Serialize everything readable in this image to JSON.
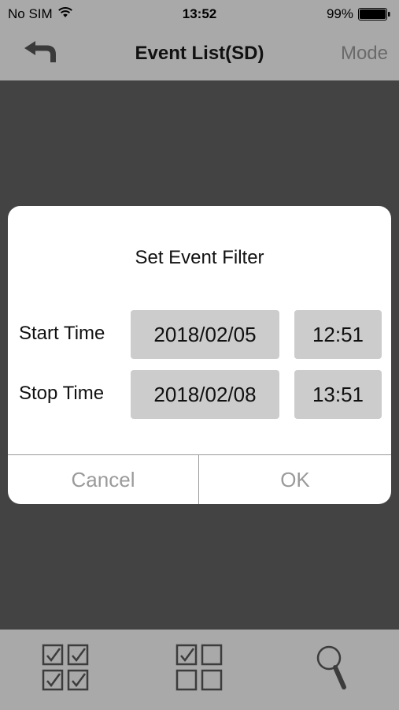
{
  "status_bar": {
    "carrier": "No SIM",
    "time": "13:52",
    "battery": "99%"
  },
  "nav": {
    "title": "Event List(SD)",
    "mode_label": "Mode",
    "back_icon": "back-arrow-icon"
  },
  "dialog": {
    "title": "Set Event Filter",
    "start": {
      "label": "Start Time",
      "date": "2018/02/05",
      "time": "12:51"
    },
    "stop": {
      "label": "Stop Time",
      "date": "2018/02/08",
      "time": "13:51"
    },
    "cancel_label": "Cancel",
    "ok_label": "OK"
  },
  "toolbar": {
    "items": [
      {
        "icon": "select-all-icon"
      },
      {
        "icon": "select-partial-icon"
      },
      {
        "icon": "search-icon"
      }
    ]
  },
  "colors": {
    "bar_background": "#a9a9a9",
    "page_background": "#434343",
    "field_background": "#cccccc",
    "disabled_text": "#9a9a9a"
  }
}
